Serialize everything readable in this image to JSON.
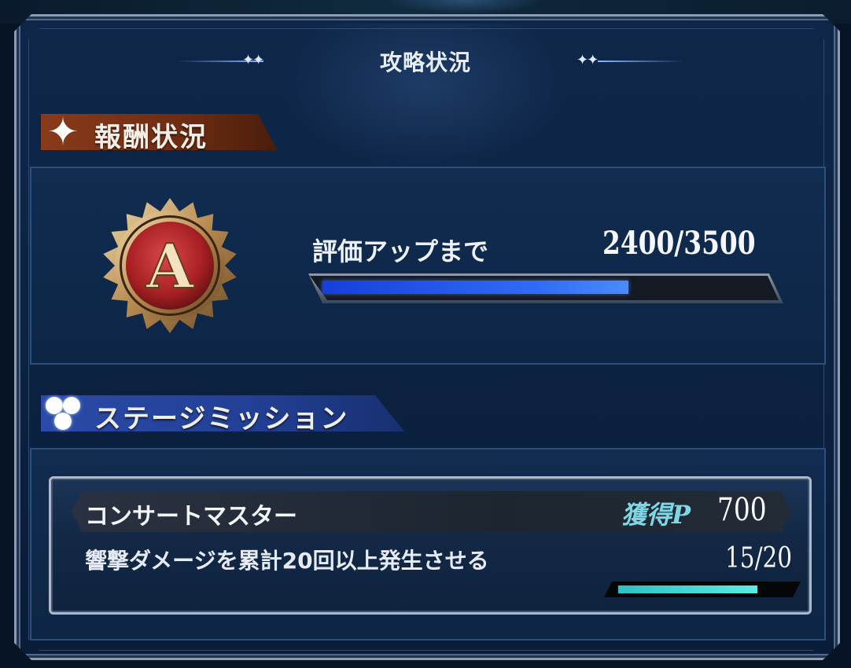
{
  "window": {
    "title": "攻略状況"
  },
  "rewards": {
    "header": "報酬状況",
    "rank": "A",
    "progress_label": "評価アップまで",
    "progress_text": "2400/3500",
    "progress_fraction": 0.6857
  },
  "missions": {
    "header": "ステージミッション",
    "items": [
      {
        "name": "コンサートマスター",
        "points_label": "獲得P",
        "points": "700",
        "description": "響撃ダメージを累計20回以上発生させる",
        "count_text": "15/20",
        "progress_fraction": 0.75
      }
    ]
  },
  "colors": {
    "reward_band": "#8a3a1a",
    "mission_band": "#2b4ba8",
    "progress_blue": "#2f6cf5",
    "mission_cyan": "#3fd0d0",
    "medal_red": "#b0262a",
    "medal_gold": "#c9a36a"
  },
  "icons": {
    "reward": "sparkle-icon",
    "mission": "hexagon-cluster-icon"
  }
}
